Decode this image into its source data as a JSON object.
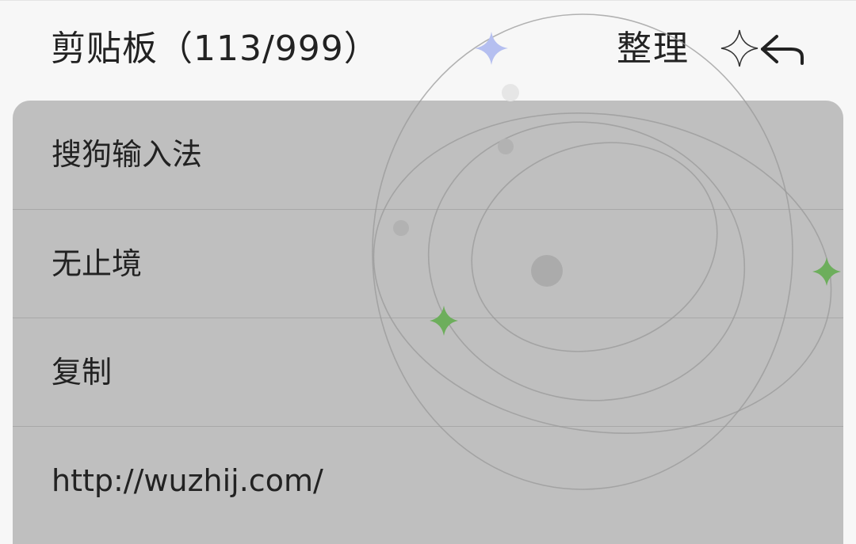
{
  "header": {
    "title": "剪贴板（113/999）",
    "organize_label": "整理",
    "back_icon": "return-arrow-icon"
  },
  "clipboard": {
    "items": [
      {
        "text": "搜狗输入法"
      },
      {
        "text": "无止境"
      },
      {
        "text": "复制"
      },
      {
        "text": "http://wuzhij.com/"
      }
    ]
  },
  "theme": {
    "page_background": "#f7f7f7",
    "panel_background": "#bfbfbf",
    "star_blue": "#b5bff0",
    "star_green": "#6dae5c"
  }
}
